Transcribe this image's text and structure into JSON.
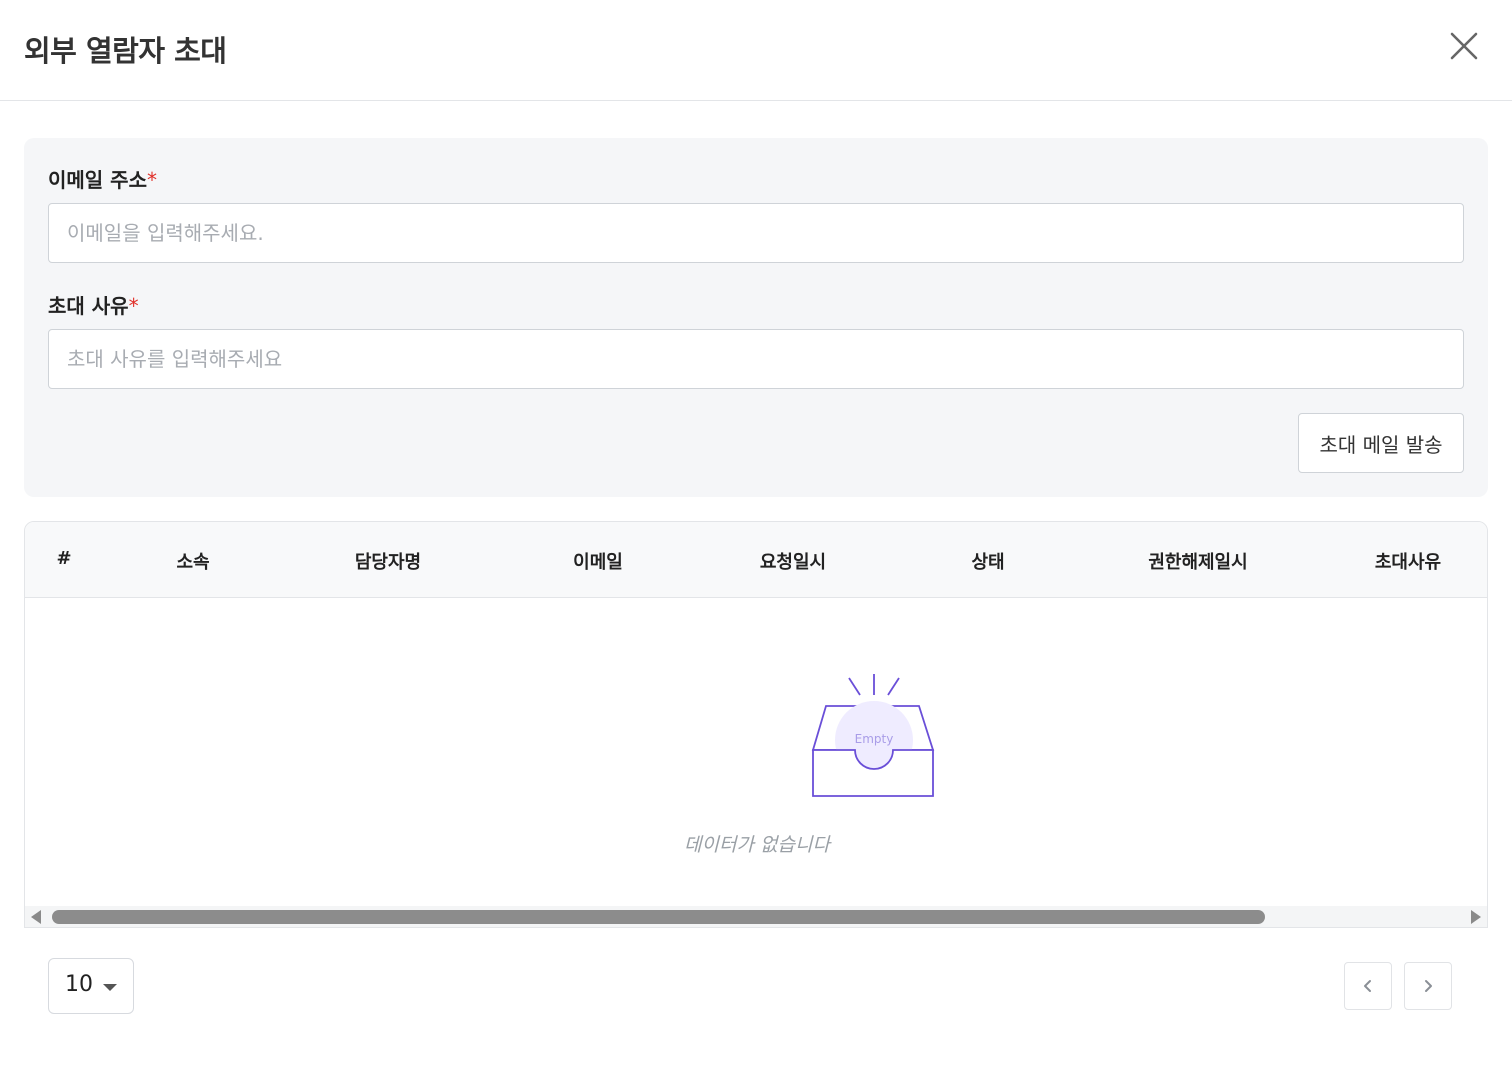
{
  "modal": {
    "title": "외부 열람자 초대",
    "close_icon": "close-icon"
  },
  "form": {
    "email": {
      "label": "이메일 주소",
      "required_mark": "*",
      "placeholder": "이메일을 입력해주세요.",
      "value": ""
    },
    "reason": {
      "label": "초대 사유",
      "required_mark": "*",
      "placeholder": "초대 사유를 입력해주세요",
      "value": ""
    },
    "send_button_label": "초대 메일 발송"
  },
  "table": {
    "columns": [
      "#",
      "소속",
      "담당자명",
      "이메일",
      "요청일시",
      "상태",
      "권한해제일시",
      "초대사유"
    ],
    "rows": [],
    "empty": {
      "icon_label": "Empty",
      "message": "데이터가 없습니다"
    }
  },
  "pagination": {
    "page_size": "10",
    "prev_icon": "chevron-left-icon",
    "next_icon": "chevron-right-icon"
  },
  "colors": {
    "required": "#e0302a",
    "empty_icon_stroke": "#6a4fd8",
    "empty_icon_fill": "#f2efff",
    "panel_bg": "#f5f6f8"
  }
}
